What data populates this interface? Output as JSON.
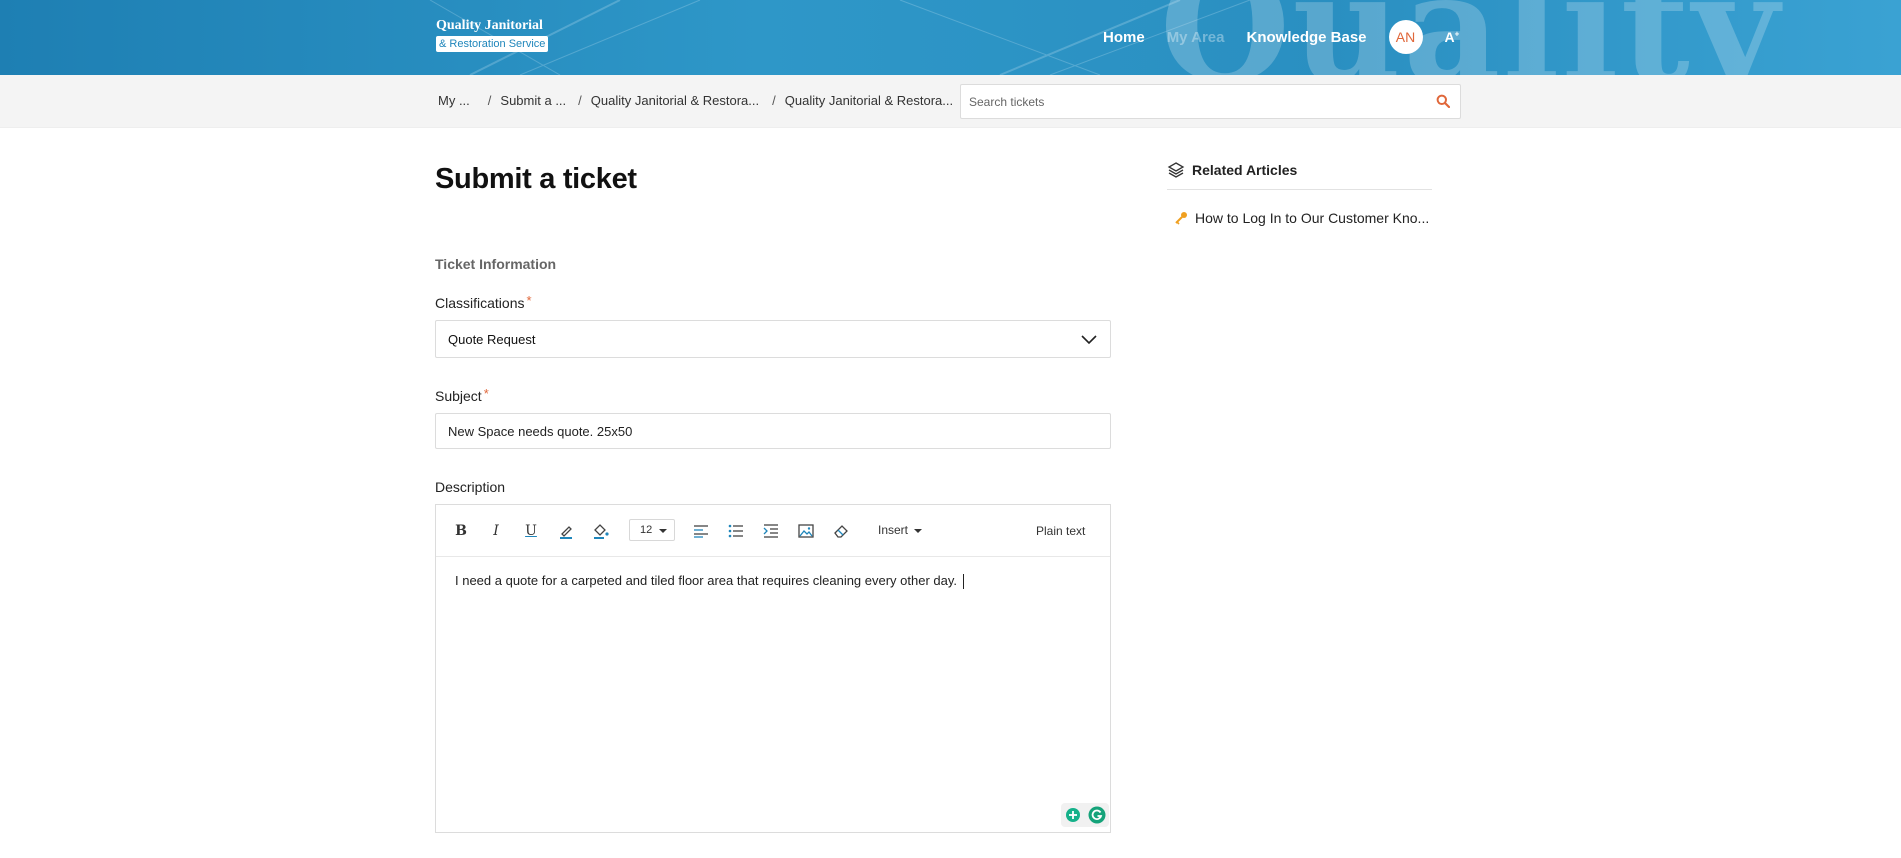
{
  "header": {
    "logo_line1": "Quality Janitorial",
    "logo_line2": "& Restoration Service",
    "watermark": "Quality",
    "nav": [
      {
        "label": "Home"
      },
      {
        "label": "My Area"
      },
      {
        "label": "Knowledge Base"
      }
    ],
    "avatar_initials": "AN",
    "font_toggle": "A",
    "colors": {
      "header_bg": "#2a8fc1",
      "accent": "#e0673a"
    }
  },
  "subbar": {
    "breadcrumbs": [
      {
        "label": "My ..."
      },
      {
        "label": "Submit a ..."
      },
      {
        "label": "Quality Janitorial & Restora..."
      },
      {
        "label": "Quality Janitorial & Restora..."
      }
    ],
    "separator": "/",
    "search": {
      "placeholder": "Search tickets",
      "value": "",
      "icon": "search-icon"
    }
  },
  "main": {
    "title": "Submit a ticket",
    "section_title": "Ticket Information",
    "classifications": {
      "label": "Classifications",
      "required_mark": "*",
      "selected": "Quote Request"
    },
    "subject": {
      "label": "Subject",
      "required_mark": "*",
      "value": "New Space needs quote. 25x50"
    },
    "description": {
      "label": "Description",
      "toolbar": {
        "bold": "B",
        "italic": "I",
        "underline": "U",
        "font_size": "12",
        "insert_label": "Insert",
        "plain_text_label": "Plain text"
      },
      "body": "I need a quote for a carpeted and tiled floor area that requires cleaning every other day."
    }
  },
  "related": {
    "title": "Related Articles",
    "items": [
      {
        "label": "How to Log In to Our Customer Kno..."
      }
    ]
  }
}
